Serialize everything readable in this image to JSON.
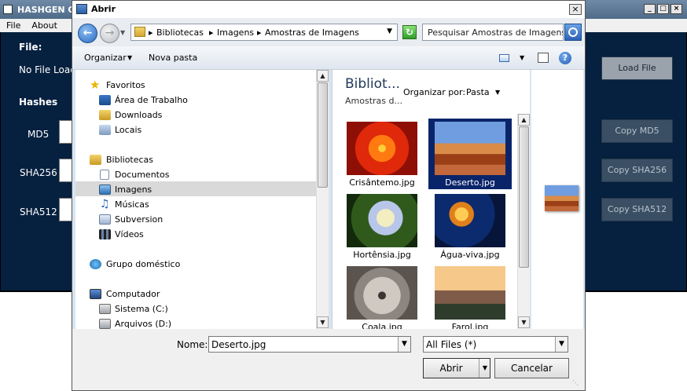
{
  "bg_app": {
    "title": "HASHGEN Q",
    "menu": [
      "File",
      "About"
    ],
    "file_heading": "File:",
    "file_status": "No File Load",
    "hashes_heading": "Hashes",
    "hash_labels": [
      "MD5",
      "SHA256",
      "SHA512"
    ],
    "buttons": {
      "load": "Load File",
      "copy_md5": "Copy MD5",
      "copy_sha256": "Copy SHA256",
      "copy_sha512": "Copy SHA512"
    },
    "window_buttons": [
      "_",
      "□",
      "×"
    ]
  },
  "dialog": {
    "title": "Abrir",
    "close": "×",
    "address": [
      "Bibliotecas",
      "Imagens",
      "Amostras de Imagens"
    ],
    "search_placeholder": "Pesquisar Amostras de Imagens",
    "toolbar": {
      "organize": "Organizar",
      "new_folder": "Nova pasta"
    },
    "nav_groups": {
      "favorites": {
        "label": "Favoritos",
        "items": [
          "Área de Trabalho",
          "Downloads",
          "Locais"
        ]
      },
      "libraries": {
        "label": "Bibliotecas",
        "items": [
          "Documentos",
          "Imagens",
          "Músicas",
          "Subversion",
          "Vídeos"
        ]
      },
      "homegroup": {
        "label": "Grupo doméstico"
      },
      "computer": {
        "label": "Computador",
        "items": [
          "Sistema (C:)",
          "Arquivos (D:)"
        ]
      }
    },
    "library_header": {
      "title": "Bibliot...",
      "subtitle": "Amostras d...",
      "arrange_label": "Organizar por:",
      "arrange_value": "Pasta"
    },
    "files": [
      "Crisântemo.jpg",
      "Deserto.jpg",
      "Hortênsia.jpg",
      "Água-viva.jpg",
      "Coala.jpg",
      "Farol.jpg"
    ],
    "selected_file": "Deserto.jpg",
    "name_label": "Nome:",
    "name_value": "Deserto.jpg",
    "filter_value": "All Files (*)",
    "open_button": "Abrir",
    "cancel_button": "Cancelar"
  }
}
